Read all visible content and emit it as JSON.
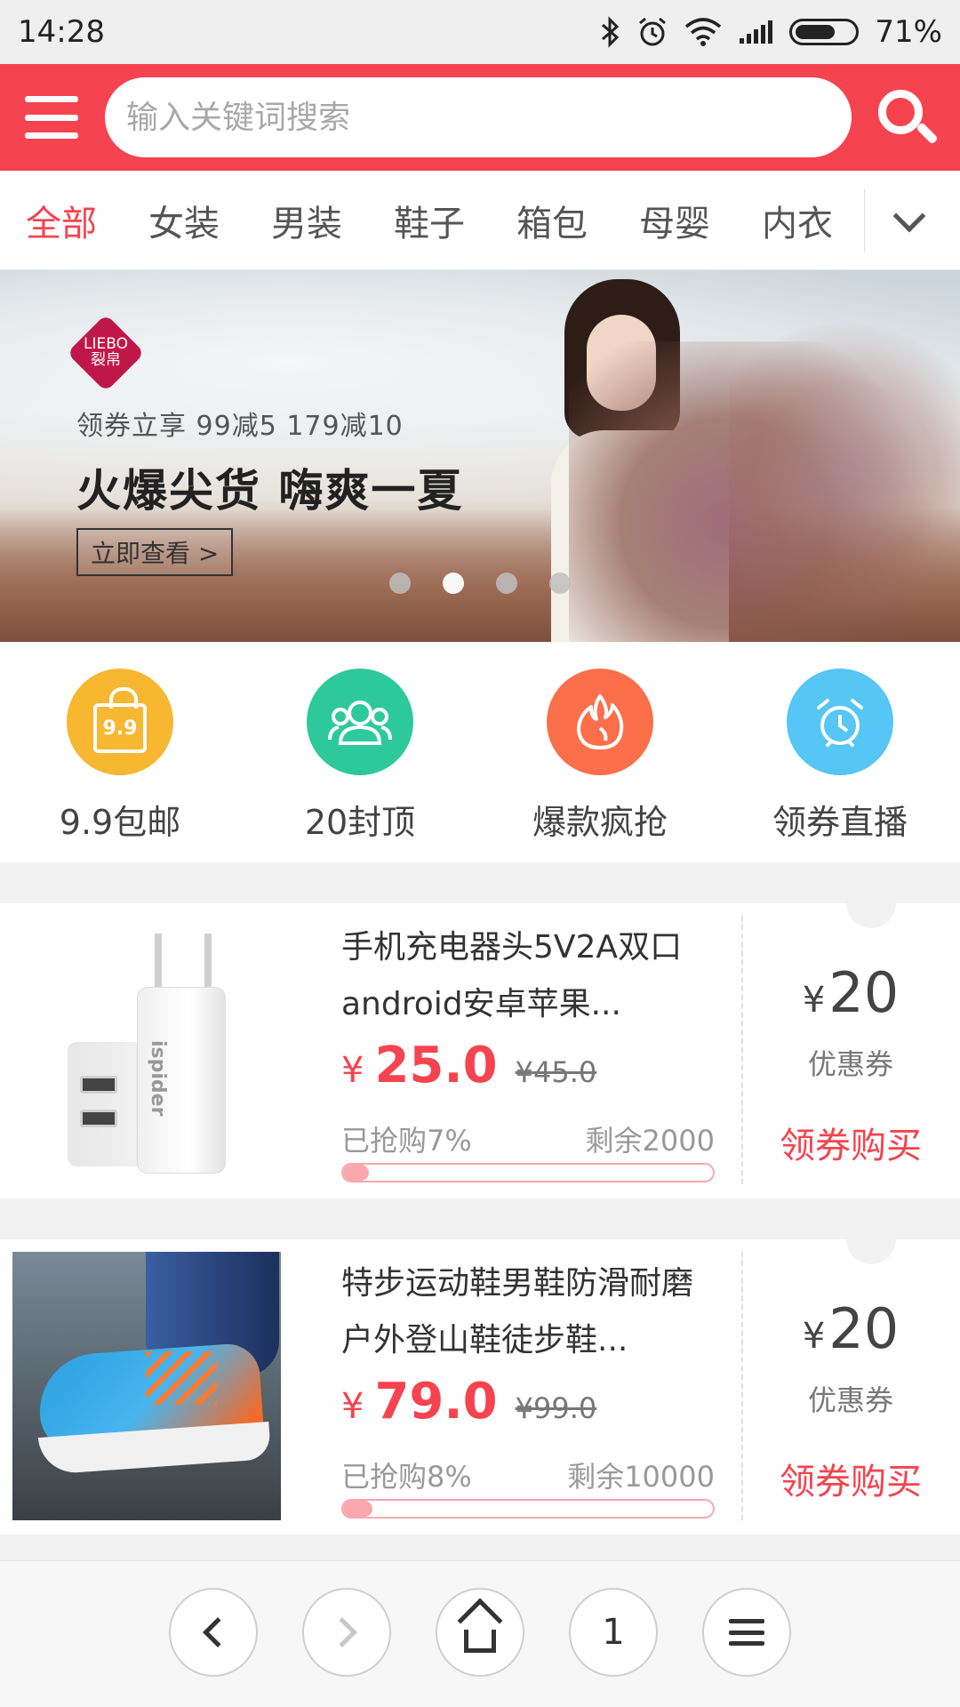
{
  "status_bar": {
    "time": "14:28",
    "battery": "71%",
    "battery_level": 0.71
  },
  "header": {
    "search_placeholder": "输入关键词搜索"
  },
  "tabs": [
    "全部",
    "女装",
    "男装",
    "鞋子",
    "箱包",
    "母婴",
    "内衣"
  ],
  "banner": {
    "logo_text": "LIEBO\n裂帛",
    "subtitle": "领券立享 99减5 179减10",
    "headline": "火爆尖货 嗨爽一夏",
    "cta": "立即查看 >",
    "dots_count": 4,
    "active_dot": 1
  },
  "shortcuts": [
    {
      "label": "9.9包邮",
      "color": "#f7b731",
      "icon": "bag-icon",
      "icon_text": "9.9"
    },
    {
      "label": "20封顶",
      "color": "#2ec99a",
      "icon": "users-icon"
    },
    {
      "label": "爆款疯抢",
      "color": "#fb6f4a",
      "icon": "fire-icon"
    },
    {
      "label": "领券直播",
      "color": "#55c6f5",
      "icon": "alarm-clock-icon"
    }
  ],
  "products": [
    {
      "title": "手机充电器头5V2A双口android安卓苹果...",
      "currency": "¥",
      "price": "25.0",
      "original_price": "¥45.0",
      "sold": "已抢购7%",
      "sold_fraction": 0.07,
      "remaining": "剩余2000",
      "coupon_currency": "¥",
      "coupon_value": "20",
      "coupon_label": "优惠券",
      "buy_label": "领券购买",
      "image_brand": "ispider"
    },
    {
      "title": "特步运动鞋男鞋防滑耐磨户外登山鞋徒步鞋...",
      "currency": "¥",
      "price": "79.0",
      "original_price": "¥99.0",
      "sold": "已抢购8%",
      "sold_fraction": 0.08,
      "remaining": "剩余10000",
      "coupon_currency": "¥",
      "coupon_value": "20",
      "coupon_label": "优惠券",
      "buy_label": "领券购买"
    }
  ],
  "bottom_nav": {
    "page_count": "1"
  }
}
